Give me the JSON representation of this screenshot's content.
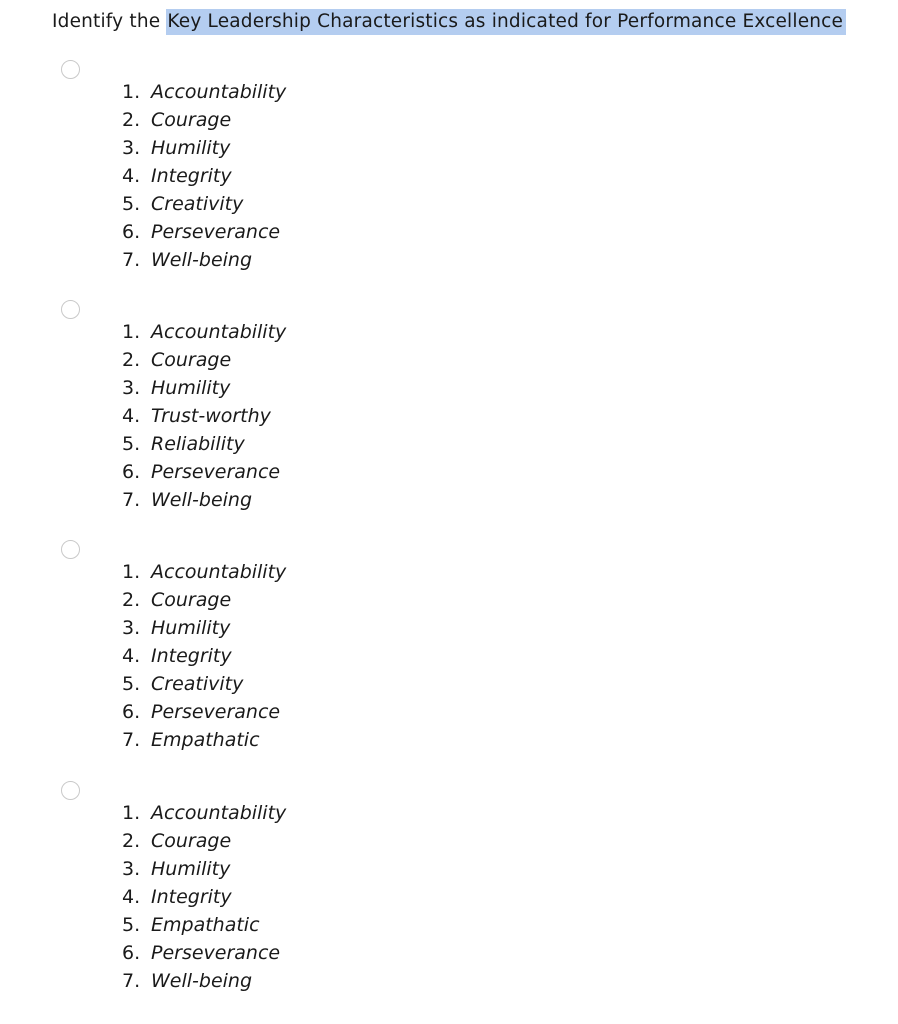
{
  "question": {
    "prefix": "Identify the ",
    "highlighted": "Key Leadership Characteristics as indicated for Performance Excellence",
    "highlight_color": "#b4cdf0"
  },
  "options": [
    {
      "id": "option-a",
      "selected": false,
      "items": [
        {
          "number": "1.",
          "text": "Accountability"
        },
        {
          "number": "2.",
          "text": "Courage"
        },
        {
          "number": "3.",
          "text": "Humility"
        },
        {
          "number": "4.",
          "text": "Integrity"
        },
        {
          "number": "5.",
          "text": "Creativity"
        },
        {
          "number": "6.",
          "text": "Perseverance"
        },
        {
          "number": "7.",
          "text": "Well-being"
        }
      ]
    },
    {
      "id": "option-b",
      "selected": false,
      "items": [
        {
          "number": "1.",
          "text": "Accountability"
        },
        {
          "number": "2.",
          "text": "Courage"
        },
        {
          "number": "3.",
          "text": "Humility"
        },
        {
          "number": "4.",
          "text": "Trust-worthy"
        },
        {
          "number": "5.",
          "text": "Reliability"
        },
        {
          "number": "6.",
          "text": "Perseverance"
        },
        {
          "number": "7.",
          "text": "Well-being"
        }
      ]
    },
    {
      "id": "option-c",
      "selected": false,
      "items": [
        {
          "number": "1.",
          "text": "Accountability"
        },
        {
          "number": "2.",
          "text": "Courage"
        },
        {
          "number": "3.",
          "text": "Humility"
        },
        {
          "number": "4.",
          "text": "Integrity"
        },
        {
          "number": "5.",
          "text": "Creativity"
        },
        {
          "number": "6.",
          "text": "Perseverance"
        },
        {
          "number": "7.",
          "text": "Empathatic"
        }
      ]
    },
    {
      "id": "option-d",
      "selected": false,
      "items": [
        {
          "number": "1.",
          "text": "Accountability"
        },
        {
          "number": "2.",
          "text": "Courage"
        },
        {
          "number": "3.",
          "text": "Humility"
        },
        {
          "number": "4.",
          "text": "Integrity"
        },
        {
          "number": "5.",
          "text": "Empathatic"
        },
        {
          "number": "6.",
          "text": "Perseverance"
        },
        {
          "number": "7.",
          "text": "Well-being"
        }
      ]
    }
  ]
}
